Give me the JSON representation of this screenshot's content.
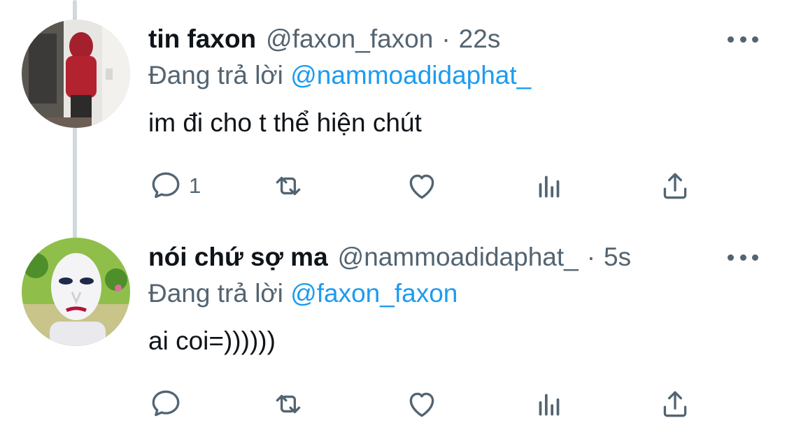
{
  "tweets": [
    {
      "name": "tin faxon",
      "handle": "@faxon_faxon",
      "separator": "·",
      "time": "22s",
      "replying_prefix": "Đang trả lời",
      "replying_to": "@nammoadidaphat_",
      "text": "im đi cho t thể hiện chút",
      "reply_count": "1",
      "avatar_icon": "person-photo-avatar"
    },
    {
      "name": "nói chứ sợ ma",
      "handle": "@nammoadidaphat_",
      "separator": "·",
      "time": "5s",
      "replying_prefix": "Đang trả lời",
      "replying_to": "@faxon_faxon",
      "text": "ai coi=))))))",
      "reply_count": "",
      "avatar_icon": "mask-character-avatar"
    }
  ],
  "action_icons": [
    "reply-icon",
    "retweet-icon",
    "like-icon",
    "analytics-icon",
    "share-icon"
  ],
  "colors": {
    "text": "#0f1419",
    "secondary": "#536471",
    "mention": "#1d9bf0",
    "thread_line": "#cfd9de"
  }
}
